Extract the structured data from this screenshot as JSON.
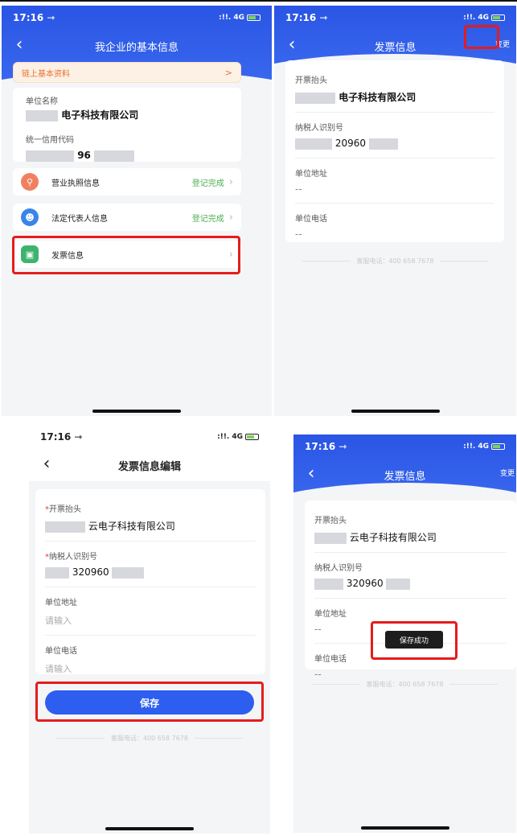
{
  "status": {
    "time": "17:16 ⇾",
    "network": "4G",
    "signal": ":!!."
  },
  "screen1": {
    "title": "我企业的基本信息",
    "chain_banner": "链上基本资料",
    "chain_chevron": ">",
    "unit_name_label": "单位名称",
    "unit_name_value": "电子科技有限公司",
    "credit_code_label": "统一信用代码",
    "credit_code_fragment": "96",
    "menu": [
      {
        "label": "营业执照信息",
        "status": "登记完成",
        "icon_color": "#f08060",
        "icon_glyph": "⚲"
      },
      {
        "label": "法定代表人信息",
        "status": "登记完成",
        "icon_color": "#3a86e8",
        "icon_glyph": "☻"
      },
      {
        "label": "发票信息",
        "status": "",
        "icon_color": "#3cb46e",
        "icon_glyph": "▣"
      }
    ]
  },
  "screen2": {
    "title": "发票信息",
    "action": "变更",
    "invoice_title_label": "开票抬头",
    "invoice_title_value": "电子科技有限公司",
    "tax_id_label": "纳税人识别号",
    "tax_id_value": "20960",
    "address_label": "单位地址",
    "address_value": "--",
    "phone_label": "单位电话",
    "phone_value": "--",
    "hotline": "客服电话：400 658 7678"
  },
  "screen3": {
    "title": "发票信息编辑",
    "invoice_title_label": "开票抬头",
    "invoice_title_value": "云电子科技有限公司",
    "tax_id_label": "纳税人识别号",
    "tax_id_value": "320960",
    "address_label": "单位地址",
    "address_placeholder": "请输入",
    "phone_label": "单位电话",
    "phone_placeholder": "请输入",
    "save_label": "保存",
    "hotline": "客服电话：400 658 7678",
    "required_mark": "*"
  },
  "screen4": {
    "title": "发票信息",
    "action": "变更",
    "invoice_title_label": "开票抬头",
    "invoice_title_value": "云电子科技有限公司",
    "tax_id_label": "纳税人识别号",
    "tax_id_value": "320960",
    "address_label": "单位地址",
    "address_value": "--",
    "phone_label": "单位电话",
    "phone_value": "--",
    "toast": "保存成功",
    "hotline": "客服电话：400 658 7678"
  },
  "colors": {
    "primary": "#2d5ef0",
    "highlight": "#e51c1c",
    "success": "#4caf50",
    "banner_text": "#e8702a"
  }
}
